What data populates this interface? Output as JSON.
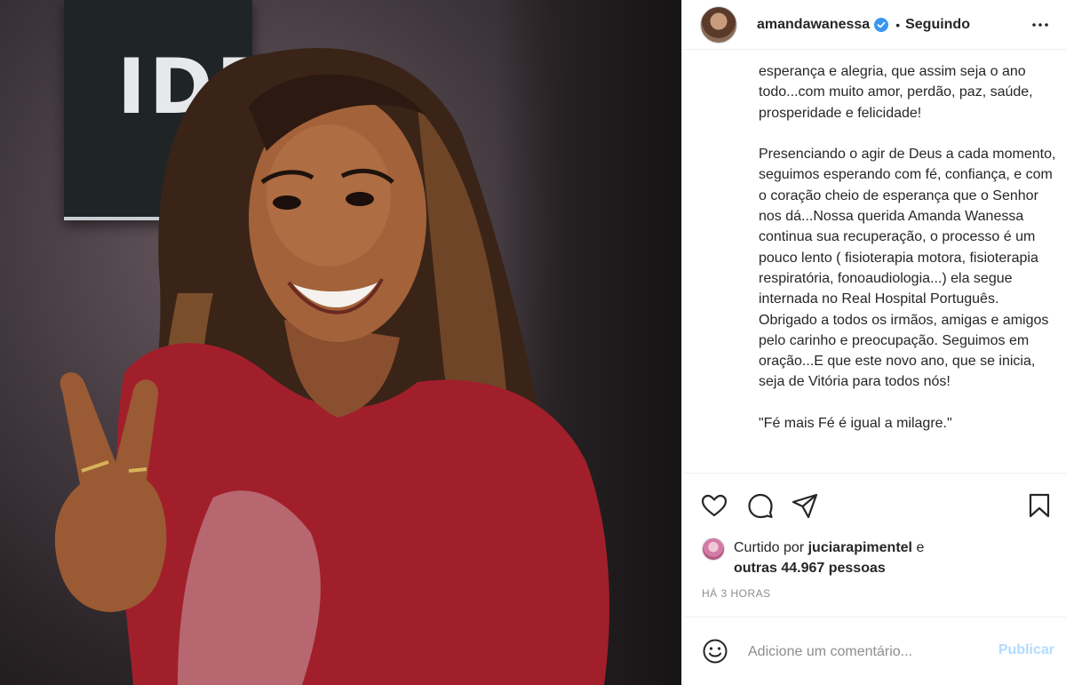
{
  "header": {
    "username": "amandawanessa",
    "separator": "•",
    "follow_status": "Seguindo"
  },
  "photo": {
    "poster_text": "IDE"
  },
  "caption": {
    "text": "esperança e alegria, que assim seja o ano todo...com muito amor, perdão, paz, saúde, prosperidade e felicidade!\n\nPresenciando o agir de Deus a cada momento, seguimos esperando com fé, confiança, e com o coração cheio de esperança que o Senhor nos dá...Nossa querida Amanda Wanessa continua sua recuperação, o processo é um pouco lento ( fisioterapia motora, fisioterapia respiratória, fonoaudiologia...) ela segue internada no Real Hospital Português. Obrigado a todos os irmãos, amigas e amigos pelo carinho e preocupação. Seguimos em oração...E que este novo ano, que se inicia, seja de Vitória para todos nós!\n\n\"Fé mais Fé é igual a milagre.\""
  },
  "likes": {
    "prefix": "Curtido por",
    "liker": "juciarapimentel",
    "connector": "e",
    "others": "outras 44.967 pessoas"
  },
  "timestamp": "HÁ 3 HORAS",
  "comment": {
    "placeholder": "Adicione um comentário...",
    "publish_label": "Publicar"
  },
  "icons": {
    "verified": "verified-badge-icon",
    "more": "more-options-icon",
    "like": "heart-icon",
    "comment": "comment-bubble-icon",
    "share": "paper-plane-icon",
    "save": "bookmark-icon",
    "emoji": "emoji-smile-icon"
  },
  "colors": {
    "verified_blue": "#3897f0",
    "publish_disabled": "#b3dbff",
    "muted_text": "#8e8e8e",
    "text": "#262626"
  }
}
